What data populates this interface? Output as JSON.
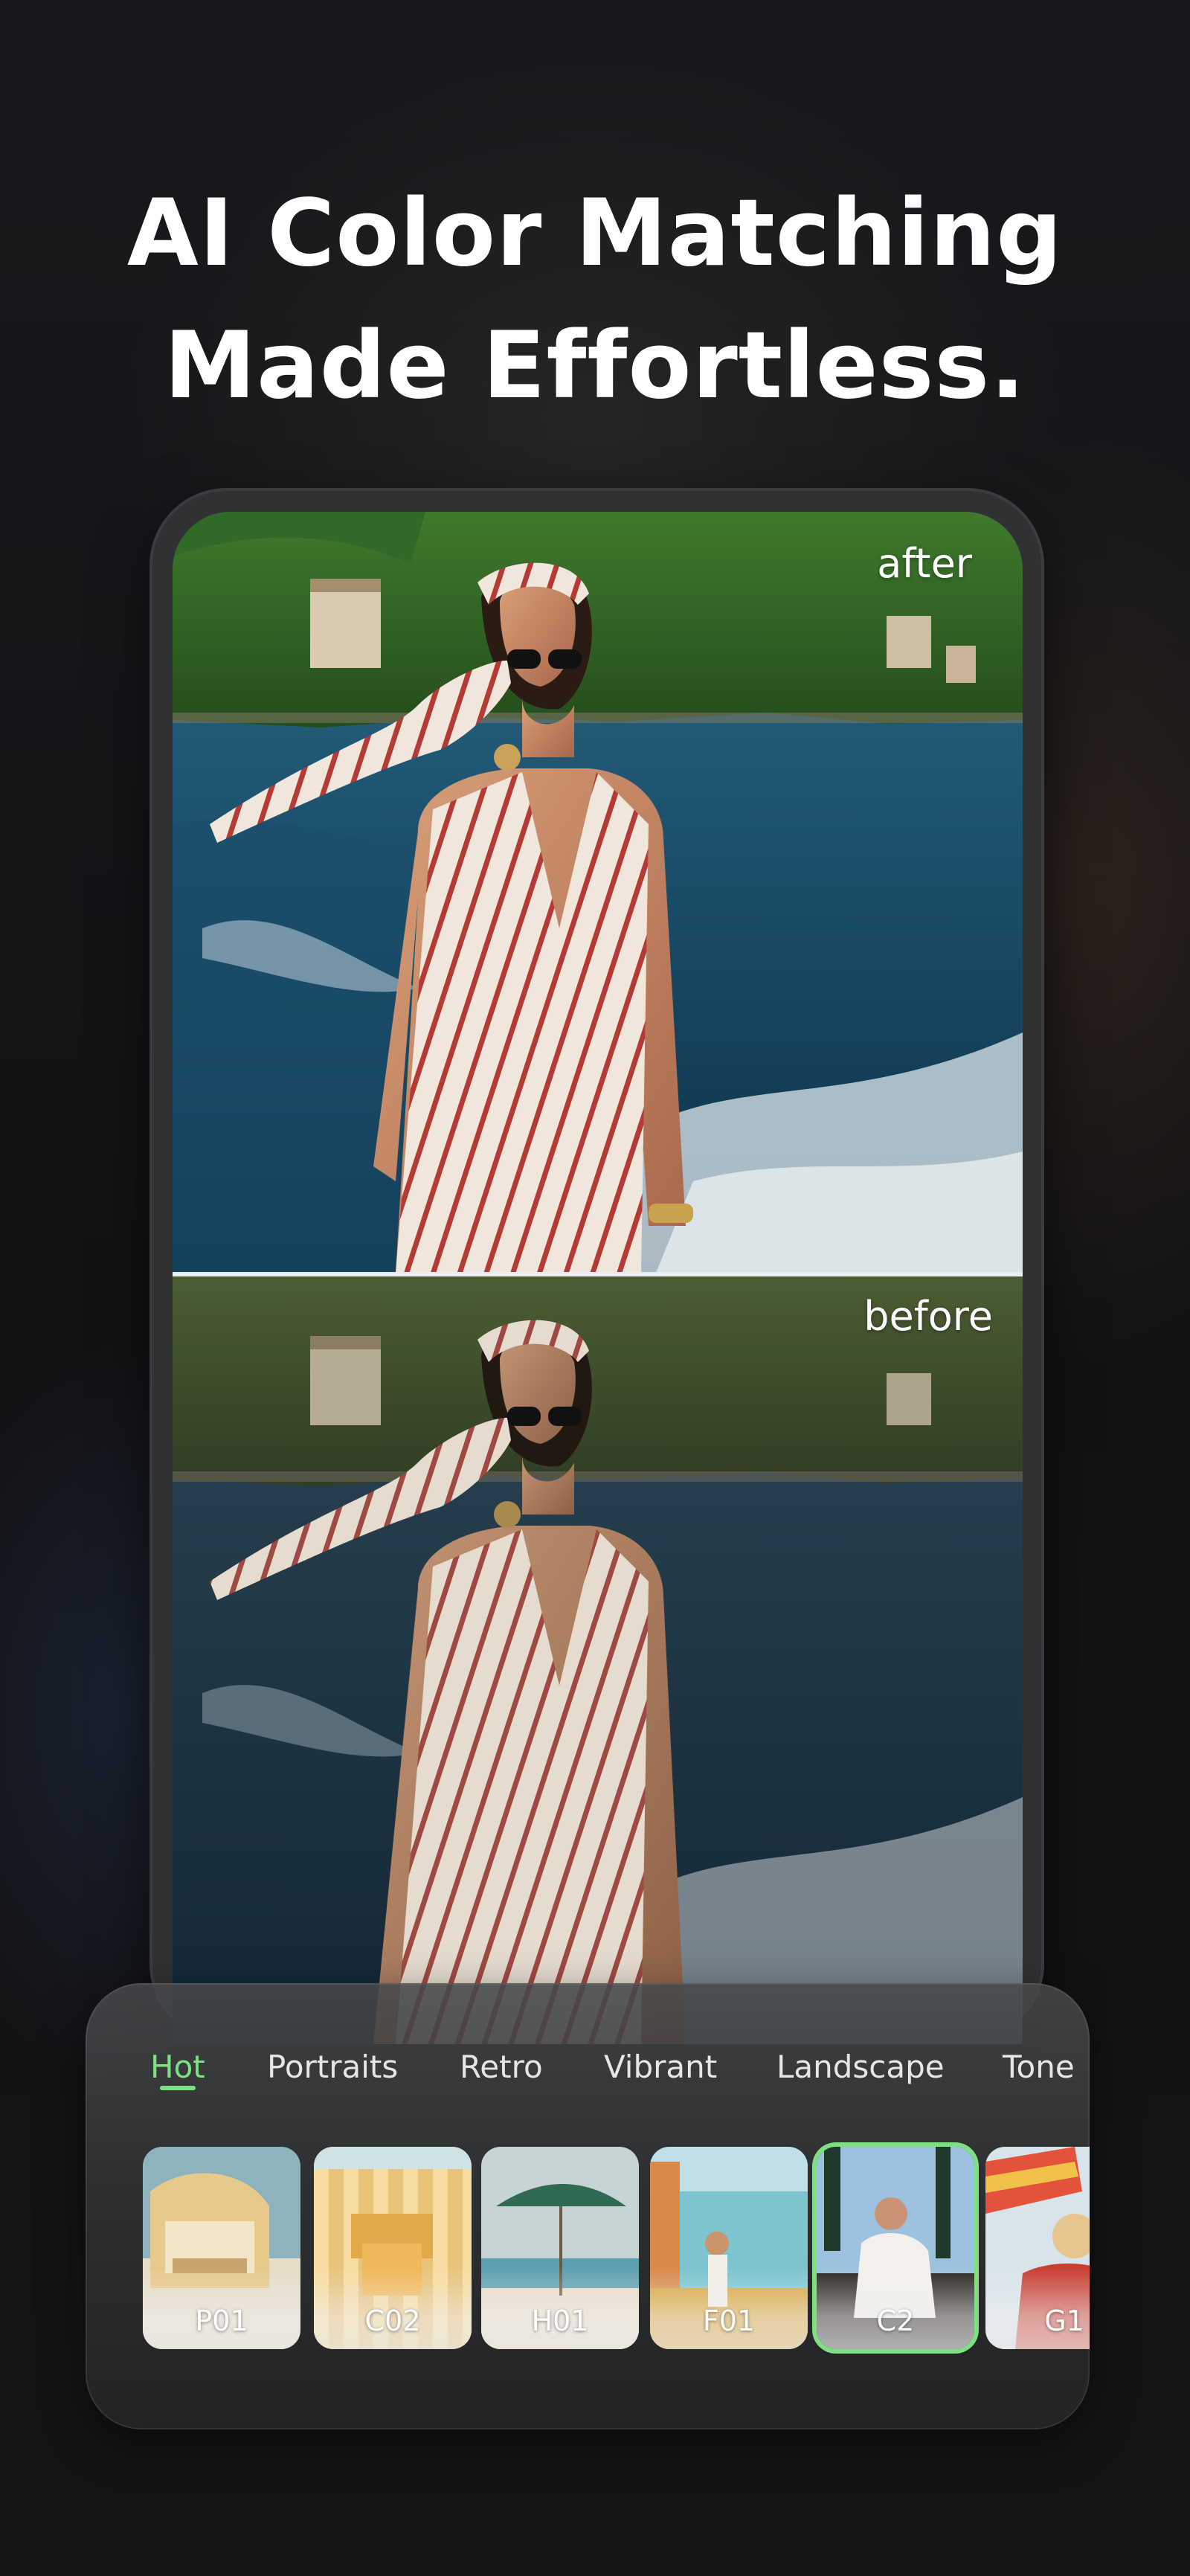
{
  "headline": {
    "line1": "AI Color Matching",
    "line2": "Made Effortless."
  },
  "preview": {
    "after_label": "after",
    "before_label": "before"
  },
  "filter_panel": {
    "tabs": [
      {
        "label": "Hot",
        "active": true
      },
      {
        "label": "Portraits",
        "active": false
      },
      {
        "label": "Retro",
        "active": false
      },
      {
        "label": "Vibrant",
        "active": false
      },
      {
        "label": "Landscape",
        "active": false
      },
      {
        "label": "Tone",
        "active": false
      }
    ],
    "presets": [
      {
        "label": "P01",
        "selected": false
      },
      {
        "label": "C02",
        "selected": false
      },
      {
        "label": "H01",
        "selected": false
      },
      {
        "label": "F01",
        "selected": false
      },
      {
        "label": "C2",
        "selected": true
      },
      {
        "label": "G1",
        "selected": false
      }
    ],
    "accent_color": "#7ee081"
  }
}
